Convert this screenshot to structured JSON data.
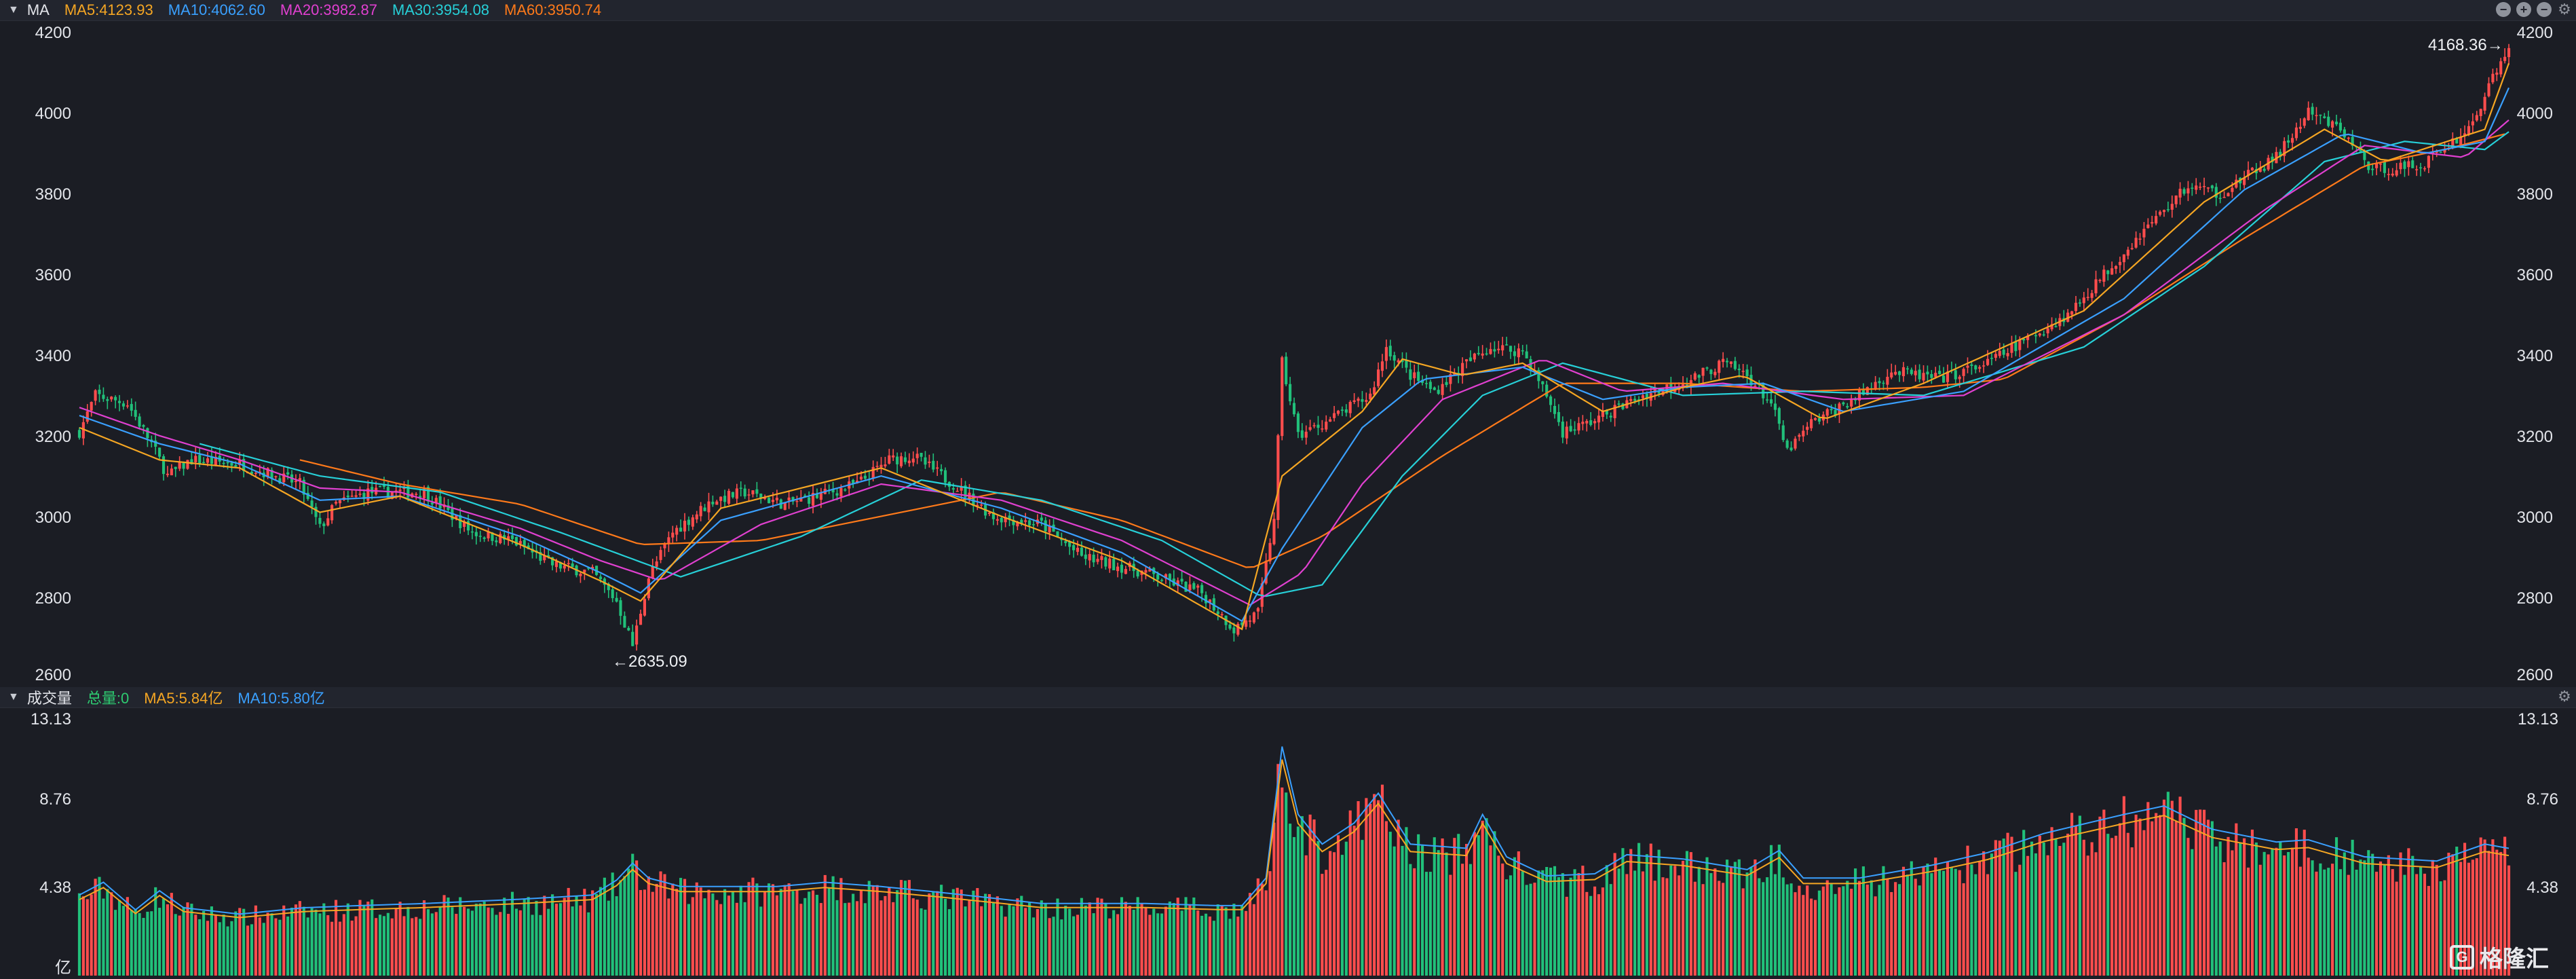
{
  "main_panel": {
    "title": "MA",
    "legend": [
      {
        "label": "MA5:4123.93",
        "color": "#f5a623"
      },
      {
        "label": "MA10:4062.60",
        "color": "#3aa0ff"
      },
      {
        "label": "MA20:3982.87",
        "color": "#e040d0"
      },
      {
        "label": "MA30:3954.08",
        "color": "#27d0d8"
      },
      {
        "label": "MA60:3950.74",
        "color": "#ff7a1a"
      }
    ],
    "y_ticks": [
      "4200",
      "4000",
      "3800",
      "3600",
      "3400",
      "3200",
      "3000",
      "2800",
      "2600"
    ],
    "annotations": {
      "high": "4168.36→",
      "low": "←2635.09"
    },
    "controls": {
      "minus": "−",
      "plus": "+",
      "minus2": "−",
      "gear": "⚙"
    }
  },
  "volume_panel": {
    "title": "成交量",
    "legend": [
      {
        "label": "总量:0",
        "color": "#2ecc71"
      },
      {
        "label": "MA5:5.84亿",
        "color": "#f5a623"
      },
      {
        "label": "MA10:5.80亿",
        "color": "#3aa0ff"
      }
    ],
    "y_ticks": [
      "13.13",
      "8.76",
      "4.38"
    ],
    "unit": "亿",
    "gear": "⚙"
  },
  "watermark": {
    "icon": "G",
    "text": "格隆汇"
  },
  "colors": {
    "up": "#ff4d4d",
    "down": "#21c07a",
    "ma5": "#f5a623",
    "ma10": "#3aa0ff",
    "ma20": "#e040d0",
    "ma30": "#27d0d8",
    "ma60": "#ff7a1a"
  },
  "chart_data": {
    "type": "line",
    "price_ylim": [
      2600,
      4200
    ],
    "volume_ylim": [
      0,
      13.13
    ],
    "price_anchors": [
      [
        0,
        3210
      ],
      [
        4,
        3300
      ],
      [
        12,
        3280
      ],
      [
        18,
        3180
      ],
      [
        22,
        3100
      ],
      [
        28,
        3140
      ],
      [
        40,
        3130
      ],
      [
        55,
        3080
      ],
      [
        60,
        2970
      ],
      [
        64,
        3030
      ],
      [
        72,
        3060
      ],
      [
        86,
        3060
      ],
      [
        98,
        2960
      ],
      [
        108,
        2940
      ],
      [
        118,
        2880
      ],
      [
        128,
        2860
      ],
      [
        134,
        2790
      ],
      [
        138,
        2680
      ],
      [
        142,
        2850
      ],
      [
        148,
        2960
      ],
      [
        158,
        3040
      ],
      [
        166,
        3060
      ],
      [
        176,
        3030
      ],
      [
        184,
        3050
      ],
      [
        194,
        3080
      ],
      [
        202,
        3140
      ],
      [
        208,
        3150
      ],
      [
        218,
        3080
      ],
      [
        228,
        3000
      ],
      [
        240,
        2980
      ],
      [
        250,
        2900
      ],
      [
        266,
        2860
      ],
      [
        280,
        2810
      ],
      [
        288,
        2720
      ],
      [
        294,
        2760
      ],
      [
        298,
        3000
      ],
      [
        300,
        3380
      ],
      [
        304,
        3200
      ],
      [
        312,
        3240
      ],
      [
        322,
        3300
      ],
      [
        326,
        3420
      ],
      [
        332,
        3350
      ],
      [
        338,
        3310
      ],
      [
        346,
        3380
      ],
      [
        352,
        3420
      ],
      [
        360,
        3410
      ],
      [
        366,
        3300
      ],
      [
        370,
        3210
      ],
      [
        376,
        3230
      ],
      [
        390,
        3300
      ],
      [
        402,
        3340
      ],
      [
        410,
        3380
      ],
      [
        416,
        3350
      ],
      [
        422,
        3280
      ],
      [
        426,
        3160
      ],
      [
        432,
        3230
      ],
      [
        444,
        3300
      ],
      [
        452,
        3360
      ],
      [
        464,
        3340
      ],
      [
        476,
        3380
      ],
      [
        496,
        3500
      ],
      [
        514,
        3700
      ],
      [
        526,
        3820
      ],
      [
        534,
        3800
      ],
      [
        548,
        3890
      ],
      [
        556,
        4000
      ],
      [
        564,
        3960
      ],
      [
        572,
        3860
      ],
      [
        584,
        3870
      ],
      [
        596,
        3960
      ],
      [
        606,
        4168
      ]
    ],
    "volume_anchors": [
      [
        0,
        3.8
      ],
      [
        6,
        4.4
      ],
      [
        14,
        3.1
      ],
      [
        20,
        4.0
      ],
      [
        26,
        3.2
      ],
      [
        40,
        2.9
      ],
      [
        56,
        3.2
      ],
      [
        70,
        3.3
      ],
      [
        86,
        3.4
      ],
      [
        110,
        3.6
      ],
      [
        128,
        3.8
      ],
      [
        134,
        4.5
      ],
      [
        138,
        5.3
      ],
      [
        142,
        4.6
      ],
      [
        150,
        4.2
      ],
      [
        174,
        4.2
      ],
      [
        186,
        4.4
      ],
      [
        200,
        4.2
      ],
      [
        216,
        3.9
      ],
      [
        240,
        3.4
      ],
      [
        266,
        3.4
      ],
      [
        284,
        3.3
      ],
      [
        290,
        3.3
      ],
      [
        296,
        4.6
      ],
      [
        300,
        10.8
      ],
      [
        304,
        7.6
      ],
      [
        310,
        6.2
      ],
      [
        318,
        7.2
      ],
      [
        324,
        8.6
      ],
      [
        332,
        6.2
      ],
      [
        346,
        6.0
      ],
      [
        350,
        7.6
      ],
      [
        356,
        5.6
      ],
      [
        366,
        4.7
      ],
      [
        378,
        4.8
      ],
      [
        386,
        5.7
      ],
      [
        400,
        5.5
      ],
      [
        416,
        5.0
      ],
      [
        424,
        5.9
      ],
      [
        430,
        4.6
      ],
      [
        444,
        4.6
      ],
      [
        462,
        5.2
      ],
      [
        476,
        5.8
      ],
      [
        490,
        6.7
      ],
      [
        510,
        7.6
      ],
      [
        520,
        8.0
      ],
      [
        532,
        6.9
      ],
      [
        548,
        6.3
      ],
      [
        556,
        6.4
      ],
      [
        570,
        5.6
      ],
      [
        588,
        5.4
      ],
      [
        600,
        6.2
      ],
      [
        606,
        6.0
      ]
    ],
    "ma_anchors": {
      "ma5": [
        [
          0,
          3220
        ],
        [
          20,
          3140
        ],
        [
          40,
          3120
        ],
        [
          60,
          3010
        ],
        [
          80,
          3050
        ],
        [
          110,
          2930
        ],
        [
          130,
          2840
        ],
        [
          140,
          2790
        ],
        [
          160,
          3020
        ],
        [
          200,
          3120
        ],
        [
          230,
          3000
        ],
        [
          260,
          2890
        ],
        [
          290,
          2720
        ],
        [
          300,
          3100
        ],
        [
          320,
          3260
        ],
        [
          330,
          3390
        ],
        [
          345,
          3350
        ],
        [
          360,
          3380
        ],
        [
          380,
          3260
        ],
        [
          400,
          3320
        ],
        [
          415,
          3350
        ],
        [
          435,
          3240
        ],
        [
          460,
          3330
        ],
        [
          500,
          3510
        ],
        [
          530,
          3780
        ],
        [
          560,
          3960
        ],
        [
          575,
          3880
        ],
        [
          600,
          3960
        ],
        [
          606,
          4124
        ]
      ],
      "ma10": [
        [
          0,
          3250
        ],
        [
          20,
          3180
        ],
        [
          40,
          3130
        ],
        [
          60,
          3040
        ],
        [
          80,
          3050
        ],
        [
          110,
          2950
        ],
        [
          130,
          2860
        ],
        [
          140,
          2810
        ],
        [
          160,
          2990
        ],
        [
          200,
          3100
        ],
        [
          230,
          3020
        ],
        [
          260,
          2910
        ],
        [
          290,
          2740
        ],
        [
          300,
          2920
        ],
        [
          320,
          3220
        ],
        [
          335,
          3340
        ],
        [
          360,
          3370
        ],
        [
          380,
          3290
        ],
        [
          400,
          3320
        ],
        [
          420,
          3330
        ],
        [
          440,
          3260
        ],
        [
          470,
          3310
        ],
        [
          510,
          3540
        ],
        [
          540,
          3810
        ],
        [
          565,
          3950
        ],
        [
          585,
          3900
        ],
        [
          600,
          3930
        ],
        [
          606,
          4063
        ]
      ],
      "ma20": [
        [
          0,
          3270
        ],
        [
          20,
          3200
        ],
        [
          40,
          3140
        ],
        [
          60,
          3070
        ],
        [
          80,
          3060
        ],
        [
          110,
          2970
        ],
        [
          130,
          2890
        ],
        [
          145,
          2840
        ],
        [
          170,
          2980
        ],
        [
          200,
          3080
        ],
        [
          230,
          3040
        ],
        [
          260,
          2940
        ],
        [
          292,
          2780
        ],
        [
          305,
          2860
        ],
        [
          320,
          3080
        ],
        [
          340,
          3290
        ],
        [
          365,
          3390
        ],
        [
          385,
          3310
        ],
        [
          410,
          3330
        ],
        [
          440,
          3290
        ],
        [
          470,
          3300
        ],
        [
          510,
          3500
        ],
        [
          545,
          3760
        ],
        [
          570,
          3920
        ],
        [
          595,
          3890
        ],
        [
          606,
          3983
        ]
      ],
      "ma30": [
        [
          30,
          3180
        ],
        [
          60,
          3100
        ],
        [
          90,
          3060
        ],
        [
          120,
          2960
        ],
        [
          150,
          2850
        ],
        [
          180,
          2950
        ],
        [
          210,
          3090
        ],
        [
          240,
          3040
        ],
        [
          270,
          2940
        ],
        [
          295,
          2800
        ],
        [
          310,
          2830
        ],
        [
          330,
          3100
        ],
        [
          350,
          3300
        ],
        [
          370,
          3380
        ],
        [
          400,
          3300
        ],
        [
          430,
          3310
        ],
        [
          460,
          3300
        ],
        [
          500,
          3420
        ],
        [
          530,
          3620
        ],
        [
          560,
          3880
        ],
        [
          580,
          3930
        ],
        [
          600,
          3910
        ],
        [
          606,
          3954
        ]
      ],
      "ma60": [
        [
          55,
          3140
        ],
        [
          80,
          3080
        ],
        [
          110,
          3030
        ],
        [
          140,
          2930
        ],
        [
          170,
          2940
        ],
        [
          200,
          3000
        ],
        [
          230,
          3060
        ],
        [
          260,
          2990
        ],
        [
          292,
          2870
        ],
        [
          310,
          2950
        ],
        [
          340,
          3150
        ],
        [
          370,
          3330
        ],
        [
          400,
          3330
        ],
        [
          430,
          3310
        ],
        [
          460,
          3320
        ],
        [
          480,
          3340
        ],
        [
          510,
          3500
        ],
        [
          540,
          3690
        ],
        [
          570,
          3870
        ],
        [
          590,
          3910
        ],
        [
          606,
          3951
        ]
      ]
    }
  }
}
